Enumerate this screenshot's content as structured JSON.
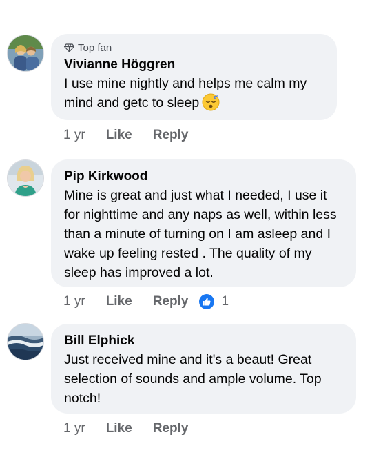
{
  "comments": [
    {
      "badge": "Top fan",
      "badge_icon": "diamond-icon",
      "name": "Vivianne Höggren",
      "text": "I use mine nightly and helps me calm my mind and getc to sleep",
      "emoji": "sleeping-face-emoji",
      "time": "1 yr",
      "like": "Like",
      "reply": "Reply"
    },
    {
      "name": "Pip Kirkwood",
      "text": "Mine is great and just what I needed, I use it for nighttime and any naps as well, within less than a minute of turning on I am asleep and I wake up feeling rested . The quality of my sleep has improved a lot.",
      "time": "1 yr",
      "like": "Like",
      "reply": "Reply",
      "reaction_icon": "like-reaction-icon",
      "reaction_count": "1"
    },
    {
      "name": "Bill Elphick",
      "text": "Just received mine and it's a beaut! Great selection of sounds and ample volume. Top notch!",
      "time": "1 yr",
      "like": "Like",
      "reply": "Reply"
    }
  ],
  "colors": {
    "bubble": "#f0f2f5",
    "meta_text": "#65676b",
    "like_blue": "#1877f2"
  }
}
